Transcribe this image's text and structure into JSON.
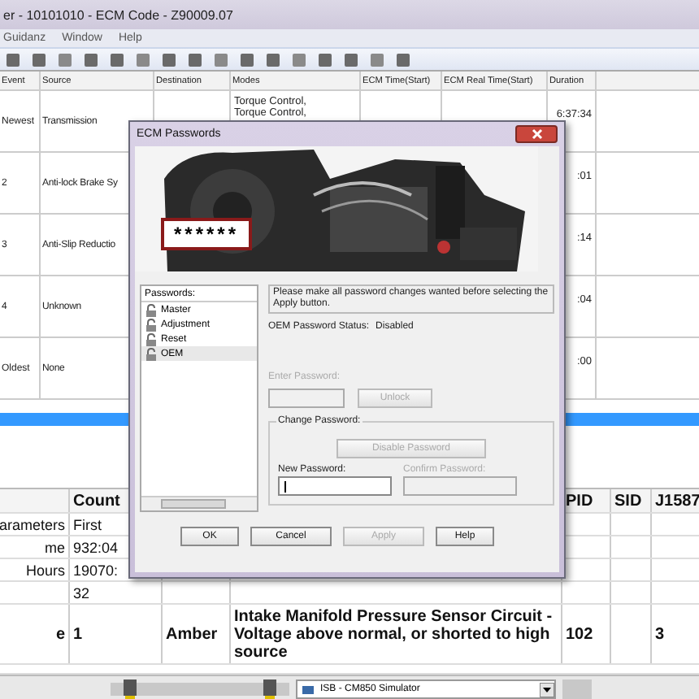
{
  "window": {
    "title": "er - 10101010 - ECM Code - Z90009.07"
  },
  "menu": [
    "Guidanz",
    "Window",
    "Help"
  ],
  "events_table": {
    "columns": [
      "Event",
      "Source",
      "Destination",
      "Modes",
      "ECM Time(Start)",
      "ECM Real Time(Start)",
      "Duration"
    ],
    "rows": [
      {
        "event": "Newest",
        "source": "Transmission",
        "modes": [
          "Torque Control,",
          "Torque Control,"
        ],
        "duration": "6:37:34",
        "selected": false
      },
      {
        "event": "2",
        "source": "Anti-lock Brake Sy",
        "duration": ":01",
        "selected": false
      },
      {
        "event": "3",
        "source": "Anti-Slip Reductio",
        "duration": ":14",
        "selected": false
      },
      {
        "event": "4",
        "source": "Unknown",
        "duration": ":04",
        "selected": false
      },
      {
        "event": "Oldest",
        "source": "None",
        "duration": ":00",
        "selected": false
      },
      {
        "selected": true
      }
    ]
  },
  "faults_table": {
    "header": {
      "count": "Count",
      "pid": "PID",
      "sid": "SID",
      "j1587": "J1587"
    },
    "rows": [
      {
        "column_1": "arameters",
        "count": "First",
        "bold": false
      },
      {
        "column_1": "me",
        "count": "932:04",
        "bold": false
      },
      {
        "column_1": "Hours",
        "count": "19070:",
        "bold": false
      },
      {
        "count": "32",
        "bold": false
      },
      {
        "column_1": "e",
        "count": "1",
        "column_3": "Amber",
        "column_4": "Intake Manifold Pressure Sensor Circuit - Voltage above normal, or shorted to high source",
        "pid": "102",
        "j1587": "3",
        "bold": true
      }
    ]
  },
  "status_bar": {
    "connection": "ISB - CM850 Simulator"
  },
  "dialog": {
    "title": "ECM Passwords",
    "mask_text": "******",
    "list_header": "Passwords:",
    "passwords": [
      {
        "label": "Master",
        "selected": false
      },
      {
        "label": "Adjustment",
        "selected": false
      },
      {
        "label": "Reset",
        "selected": false
      },
      {
        "label": "OEM",
        "selected": true
      }
    ],
    "message": "Please make all password changes wanted before selecting the Apply button.",
    "status_label": "OEM Password Status:",
    "status_value": "Disabled",
    "enter_label": "Enter Password:",
    "enter_disabled": true,
    "unlock": {
      "label": "Unlock",
      "disabled": true
    },
    "group_label": "Change Password:",
    "disable_button": {
      "label": "Disable Password",
      "disabled": true
    },
    "new_label": "New Password:",
    "new_disabled": false,
    "confirm_label": "Confirm Password:",
    "confirm_disabled": true,
    "buttons": [
      {
        "label": "OK",
        "disabled": false
      },
      {
        "label": "Cancel",
        "disabled": false
      },
      {
        "label": "Apply",
        "disabled": true
      },
      {
        "label": "Help",
        "disabled": false
      }
    ]
  }
}
